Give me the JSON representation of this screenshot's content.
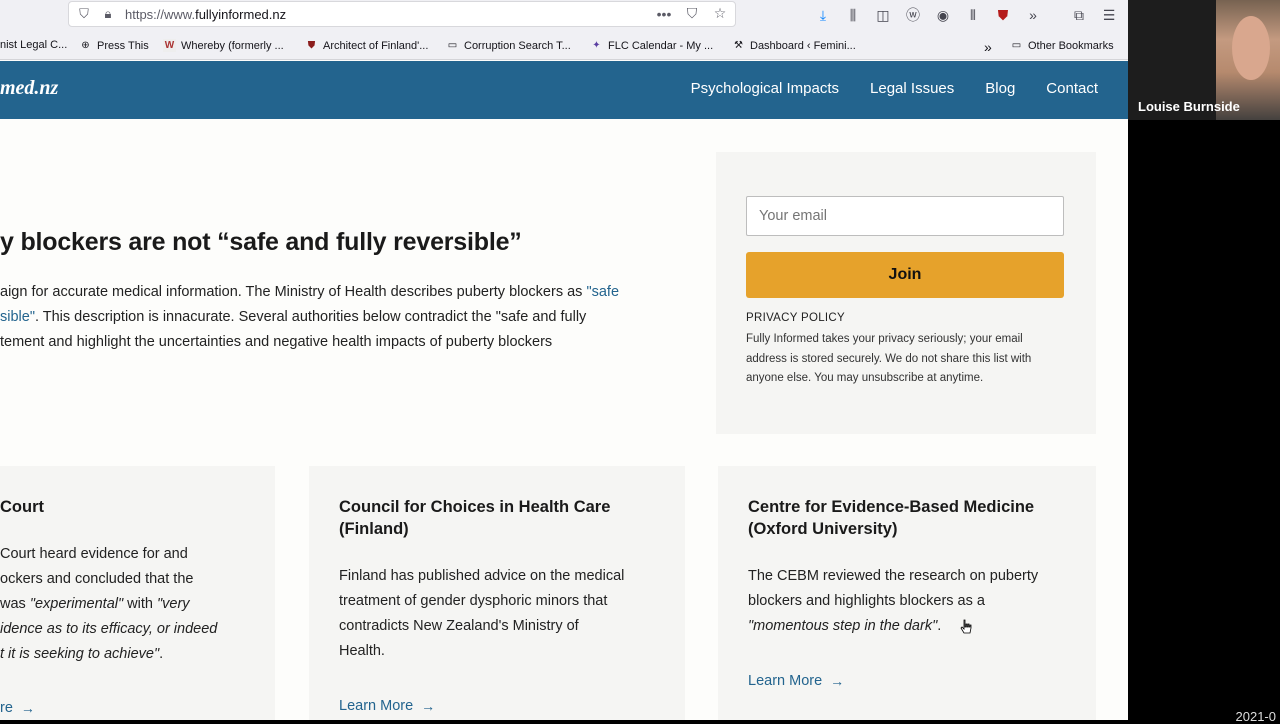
{
  "browser": {
    "url_prefix": "https://www.",
    "url_domain": "fullyinformed.nz",
    "bookmarks": [
      {
        "label": "nist Legal C...",
        "icon": "doc-icon"
      },
      {
        "label": "Press This",
        "icon": "globe-icon"
      },
      {
        "label": "Whereby (formerly ...",
        "icon": "w-icon"
      },
      {
        "label": "Architect of Finland'...",
        "icon": "shield-icon"
      },
      {
        "label": "Corruption Search T...",
        "icon": "folder-icon"
      },
      {
        "label": "FLC Calendar - My ...",
        "icon": "calendar-icon"
      },
      {
        "label": "Dashboard ‹ Femini...",
        "icon": "dashboard-icon"
      },
      {
        "label": "Other Bookmarks",
        "icon": "folder-icon"
      }
    ]
  },
  "site": {
    "logo": "med.nz",
    "nav": [
      "Psychological Impacts",
      "Legal Issues",
      "Blog",
      "Contact"
    ]
  },
  "hero": {
    "title": "y blockers are not “safe and fully reversible”",
    "line1_a": "aign for accurate medical information. The Ministry of Health describes puberty blockers as ",
    "line1_link": "\"safe",
    "line2_link": "sible\"",
    "line2_b": ". This description is innacurate. Several authorities below contradict the \"safe and fully",
    "line3": "tement and highlight the uncertainties and negative health impacts of puberty blockers"
  },
  "signup": {
    "placeholder": "Your email",
    "join_label": "Join",
    "privacy_title": "PRIVACY POLICY",
    "privacy_text": "Fully Informed takes your privacy seriously; your email address is stored securely. We do not share this list with anyone else. You may unsubscribe at anytime."
  },
  "cards": [
    {
      "title_lines": [
        "Court"
      ],
      "lines": [
        {
          "t": "Court heard evidence for and"
        },
        {
          "t": "ockers and concluded that the"
        },
        {
          "t": " was ",
          "i": "\"experimental\"",
          "t2": " with ",
          "i2": "\"very"
        },
        {
          "i": "idence as to its efficacy, or indeed"
        },
        {
          "i": "t it is seeking to achieve\"",
          "t2": "."
        }
      ],
      "more": "re"
    },
    {
      "title_lines": [
        "Council for Choices in Health Care",
        "(Finland)"
      ],
      "lines": [
        {
          "t": "Finland has published advice on the medical"
        },
        {
          "t": "treatment of gender dysphoric minors that"
        },
        {
          "t": "contradicts New Zealand's Ministry of"
        },
        {
          "t": "Health."
        }
      ],
      "more": "Learn More"
    },
    {
      "title_lines": [
        "Centre for Evidence-Based Medicine",
        "(Oxford University)"
      ],
      "lines": [
        {
          "t": "The CEBM reviewed the research on puberty"
        },
        {
          "t": "blockers and highlights blockers as a"
        },
        {
          "i": "\"momentous step in the dark\"",
          "t2": "."
        }
      ],
      "more": "Learn More"
    }
  ],
  "webcam": {
    "name": "Louise Burnside",
    "clock": "2021-0"
  }
}
